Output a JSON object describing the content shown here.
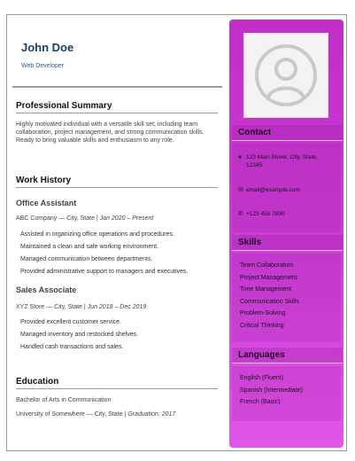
{
  "header": {
    "name": "John Doe",
    "role": "Web Developer"
  },
  "summary": {
    "title": "Professional Summary",
    "text": "Highly motivated individual with a versatile skill set, including team collaboration, project management, and strong communication skills. Ready to bring valuable skills and enthusiasm to any role."
  },
  "work": {
    "title": "Work History",
    "jobs": [
      {
        "title": "Office Assistant",
        "company": "ABC Company — City, State | ",
        "dates": "Jan 2020 – Present",
        "duties": [
          "Assisted in organizing office operations and procedures.",
          "Maintained a clean and safe working environment.",
          "Managed communication between departments.",
          "Provided administrative support to managers and executives."
        ]
      },
      {
        "title": "Sales Associate",
        "company": "XYZ Store — City, State | ",
        "dates": "Jun 2018 – Dec 2019",
        "duties": [
          "Provided excellent customer service.",
          "Managed inventory and restocked shelves.",
          "Handled cash transactions and sales."
        ]
      }
    ]
  },
  "education": {
    "title": "Education",
    "degree": "Bachelor of Arts in Communication",
    "school": "University of Somewhere — City, State | ",
    "grad": "Graduation: 2017"
  },
  "contact": {
    "title": "Contact",
    "address": "123 Main Street, City, State, 12345",
    "email": "email@example.com",
    "phone": "+123 456 7890"
  },
  "skills": {
    "title": "Skills",
    "items": [
      "Team Collaboration",
      "Project Management",
      "Time Management",
      "Communication Skills",
      "Problem-Solving",
      "Critical Thinking"
    ]
  },
  "languages": {
    "title": "Languages",
    "items": [
      "English (Fluent)",
      "Spanish (Intermediate)",
      "French (Basic)"
    ]
  },
  "colors": {
    "sidebar": "#c82ed0",
    "name": "#1e3d66",
    "role": "#2b5a8e"
  },
  "icons": {
    "photo": "avatar-placeholder-icon",
    "address": "map-pin-icon",
    "email": "envelope-icon",
    "phone": "phone-icon"
  }
}
